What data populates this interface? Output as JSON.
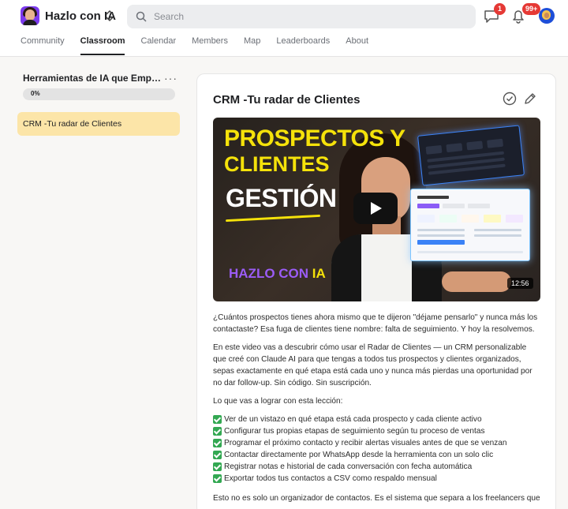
{
  "group": {
    "name": "Hazlo con IA"
  },
  "search": {
    "placeholder": "Search"
  },
  "header": {
    "chat_badge": "1",
    "notifications_badge": "99+"
  },
  "tabs": [
    {
      "label": "Community",
      "active": false
    },
    {
      "label": "Classroom",
      "active": true
    },
    {
      "label": "Calendar",
      "active": false
    },
    {
      "label": "Members",
      "active": false
    },
    {
      "label": "Map",
      "active": false
    },
    {
      "label": "Leaderboards",
      "active": false
    },
    {
      "label": "About",
      "active": false
    }
  ],
  "sidebar": {
    "course_title": "Herramientas de IA que Empoderan",
    "progress_label": "0%",
    "progress": 0,
    "lessons": [
      {
        "label": "CRM -Tu radar de Clientes",
        "selected": true
      }
    ]
  },
  "lesson": {
    "title": "CRM -Tu radar de Clientes",
    "video": {
      "line1": "PROSPECTOS Y",
      "line2": "CLIENTES",
      "line3": "GESTIÓN",
      "brand_word1": "HAZLO CON",
      "brand_word2": "IA",
      "duration": "12:56"
    },
    "paragraphs": [
      "¿Cuántos prospectos tienes ahora mismo que te dijeron \"déjame pensarlo\" y nunca más los contactaste? Esa fuga de clientes tiene nombre: falta de seguimiento. Y hoy la resolvemos.",
      "En este video vas a descubrir cómo usar el Radar de Clientes — un CRM personalizable que creé con Claude AI para que tengas a todos tus prospectos y clientes organizados, sepas exactamente en qué etapa está cada uno y nunca más pierdas una oportunidad por no dar follow-up. Sin código. Sin suscripción.",
      "Lo que vas a lograr con esta lección:"
    ],
    "checklist": [
      "Ver de un vistazo en qué etapa está cada prospecto y cada cliente activo",
      "Configurar tus propias etapas de seguimiento según tu proceso de ventas",
      "Programar el próximo contacto y recibir alertas visuales antes de que se venzan",
      "Contactar directamente por WhatsApp desde la herramienta con un solo clic",
      "Registrar notas e historial de cada conversación con fecha automática",
      "Exportar todos tus contactos a CSV como respaldo mensual"
    ],
    "closing": "Esto no es solo un organizador de contactos. Es el sistema que separa a los freelancers que"
  },
  "colors": {
    "accent": "#fce5a8",
    "badge": "#e53935",
    "check": "#33a852",
    "video_title": "#f5e20a",
    "brand_purple": "#9b5cf6"
  }
}
